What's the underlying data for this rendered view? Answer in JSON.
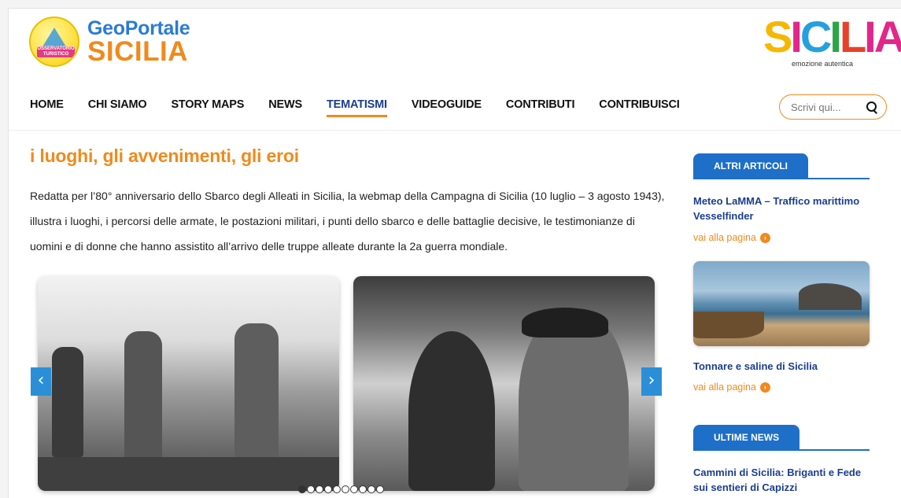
{
  "header": {
    "logo_top": "GeoPortale",
    "logo_bottom": "SICILIA",
    "badge_text": "OSSERVATORIO TURISTICO",
    "brand_letters": [
      "S",
      "I",
      "C",
      "I",
      "L",
      "IA"
    ],
    "brand_tagline": "emozione autentica"
  },
  "nav": {
    "items": [
      {
        "label": "HOME"
      },
      {
        "label": "CHI SIAMO"
      },
      {
        "label": "STORY MAPS"
      },
      {
        "label": "NEWS"
      },
      {
        "label": "TEMATISMI"
      },
      {
        "label": "VIDEOGUIDE"
      },
      {
        "label": "CONTRIBUTI"
      },
      {
        "label": "CONTRIBUISCI"
      }
    ],
    "active": "TEMATISMI"
  },
  "search": {
    "placeholder": "Scrivi qui..."
  },
  "main": {
    "title": "i luoghi, gli avvenimenti, gli eroi",
    "text": "Redatta per l’80° anniversario dello Sbarco degli Alleati in Sicilia, la webmap della Campagna di Sicilia (10 luglio – 3 agosto 1943), illustra i luoghi, i percorsi delle armate, le postazioni militari, i punti dello sbarco e delle battaglie decisive, le testimonianze di uomini e di donne che hanno assistito all’arrivo delle truppe alleate durante la 2a guerra mondiale."
  },
  "slider": {
    "prev_glyph": "‹",
    "next_glyph": "›",
    "dot_count": 10,
    "active_dot": 0
  },
  "sidebar": {
    "altri_tab": "ALTRI ARTICOLI",
    "article1_title": "Meteo LaMMA – Traffico marittimo Vesselfinder",
    "article1_more": "vai alla pagina",
    "article2_title": "Tonnare e saline di Sicilia",
    "article2_more": "vai alla pagina",
    "news_tab": "ULTIME NEWS",
    "news1_title": "Cammini di Sicilia: Briganti e Fede sui sentieri di Capizzi"
  },
  "colors": {
    "accent_orange": "#f08a1c",
    "nav_blue": "#1b3d8f",
    "tab_blue": "#1e6fc7"
  }
}
